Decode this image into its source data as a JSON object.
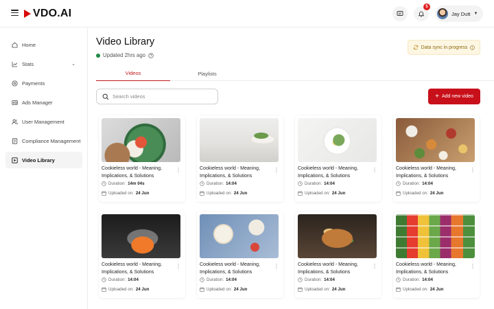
{
  "app": {
    "brand": "VDO.AI",
    "accent": "#c8101a"
  },
  "header": {
    "notifications_count": "5",
    "user_name": "Jay Dutt"
  },
  "sidebar": {
    "items": [
      {
        "label": "Home",
        "icon": "home-icon"
      },
      {
        "label": "Stats",
        "icon": "chart-icon"
      },
      {
        "label": "Payments",
        "icon": "payments-icon"
      },
      {
        "label": "Ads Manager",
        "icon": "ads-icon"
      },
      {
        "label": "User Management",
        "icon": "users-icon"
      },
      {
        "label": "Compliance Management",
        "icon": "document-icon"
      },
      {
        "label": "Video Library",
        "icon": "video-icon",
        "active": true
      }
    ]
  },
  "main": {
    "title": "Video Library",
    "updated": "Updated 2hrs ago",
    "sync_status": "Data sync in progress",
    "tabs": [
      {
        "label": "Videos",
        "active": true
      },
      {
        "label": "Playlists",
        "active": false
      }
    ],
    "search": {
      "placeholder": "Search videos",
      "value": ""
    },
    "add_button": "Add new video"
  },
  "videos": [
    {
      "title": "Cookieless world - Meaning, Implications, & Solutions",
      "duration_label": "Duration:",
      "duration": "14m 04s",
      "uploaded_label": "Uploaded on:",
      "uploaded": "24 Jun"
    },
    {
      "title": "Cookieless world - Meaning, Implications, & Solutions",
      "duration_label": "Duration:",
      "duration": "14:04",
      "uploaded_label": "Uploaded on:",
      "uploaded": "24 Jun"
    },
    {
      "title": "Cookieless world - Meaning, Implications, & Solutions",
      "duration_label": "Duration:",
      "duration": "14:04",
      "uploaded_label": "Uploaded on:",
      "uploaded": "24 Jun"
    },
    {
      "title": "Cookieless world - Meaning, Implications, & Solutions",
      "duration_label": "Duration:",
      "duration": "14:04",
      "uploaded_label": "Uploaded on:",
      "uploaded": "24 Jun"
    },
    {
      "title": "Cookieless world - Meaning, Implications, & Solutions",
      "duration_label": "Duration:",
      "duration": "14:04",
      "uploaded_label": "Uploaded on:",
      "uploaded": "24 Jun"
    },
    {
      "title": "Cookieless world - Meaning, Implications, & Solutions",
      "duration_label": "Duration:",
      "duration": "14:04",
      "uploaded_label": "Uploaded on:",
      "uploaded": "24 Jun"
    },
    {
      "title": "Cookieless world - Meaning, Implications, & Solutions",
      "duration_label": "Duration:",
      "duration": "14:04",
      "uploaded_label": "Uploaded on:",
      "uploaded": "24 Jun"
    },
    {
      "title": "Cookieless world - Meaning, Implications, & Solutions",
      "duration_label": "Duration:",
      "duration": "14:04",
      "uploaded_label": "Uploaded on:",
      "uploaded": "24 Jun"
    }
  ]
}
